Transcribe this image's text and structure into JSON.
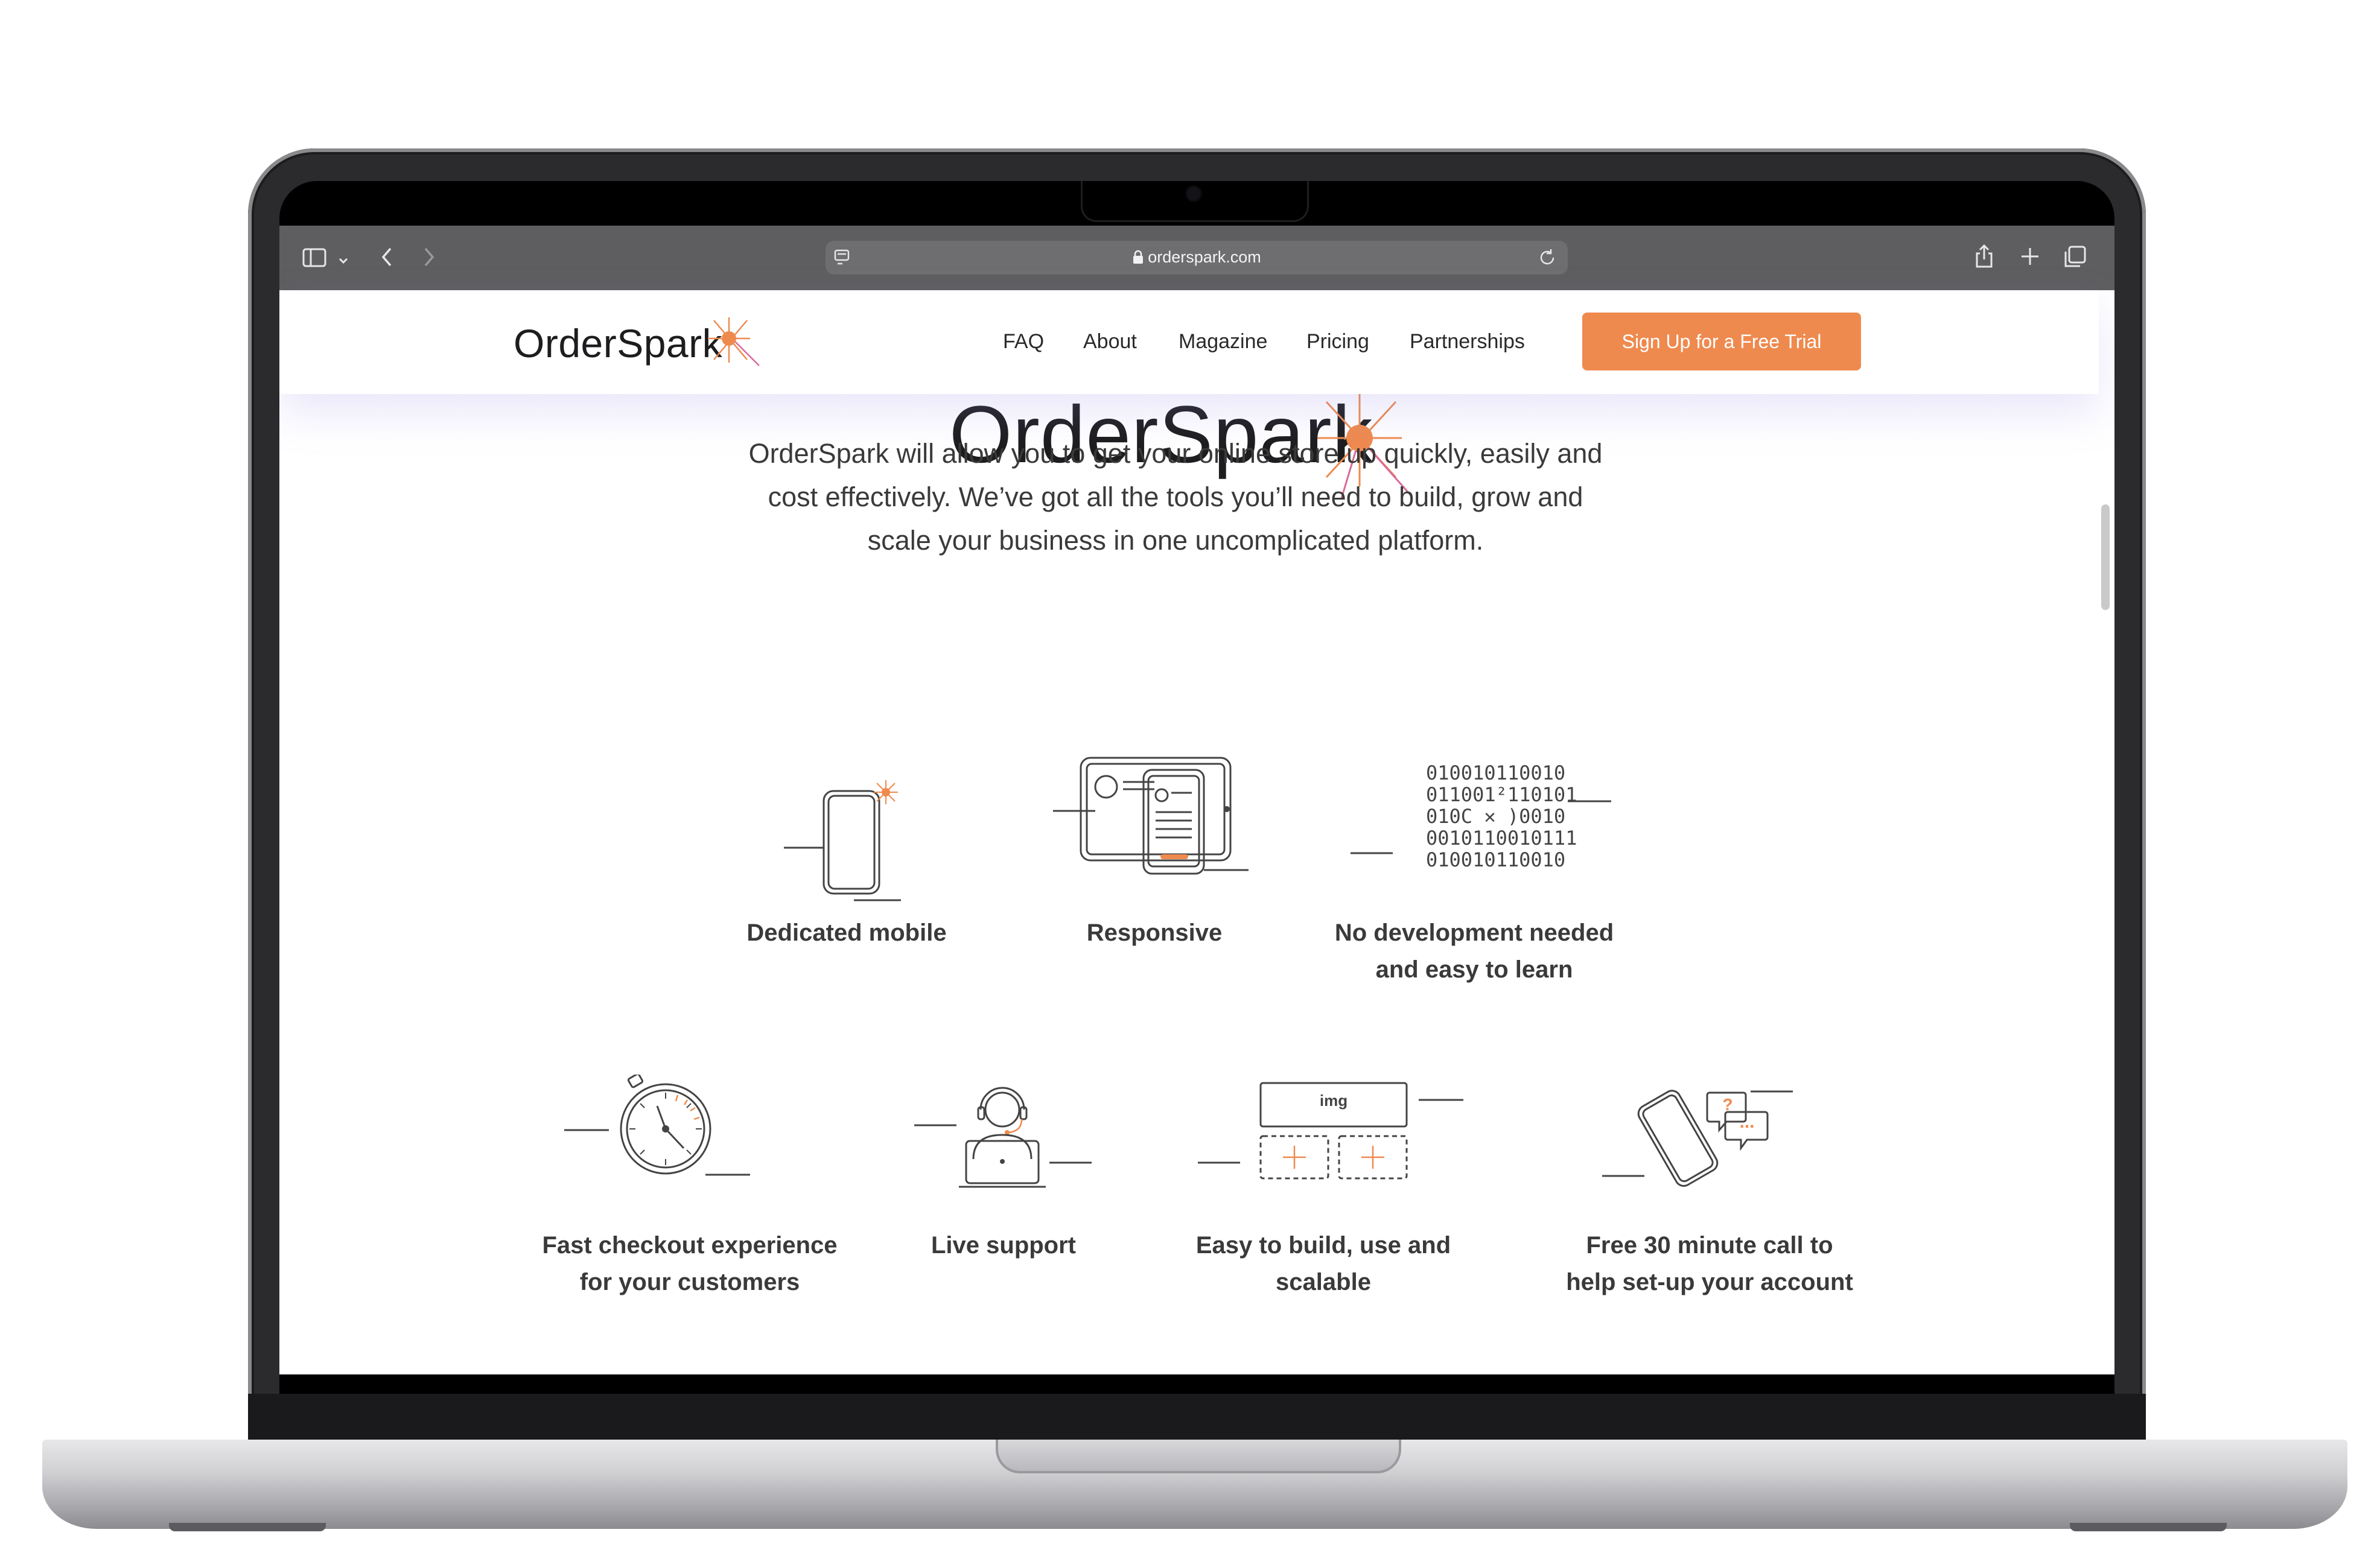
{
  "browser": {
    "url": "orderspark.com"
  },
  "site": {
    "logo": "OrderSpark",
    "nav": [
      "FAQ",
      "About",
      "Magazine",
      "Pricing",
      "Partnerships"
    ],
    "cta_label": "Sign Up for a Free Trial",
    "accent_color": "#ef8a4f"
  },
  "hero": {
    "logo": "OrderSpark",
    "intro_lines": [
      "OrderSpark will allow you to get your online store up quickly, easily and",
      "cost effectively. We’ve got all the tools you’ll need to build, grow and",
      "scale your business in one uncomplicated platform."
    ]
  },
  "features_row1": [
    {
      "icon": "mobile-icon",
      "label_lines": [
        "Dedicated mobile"
      ]
    },
    {
      "icon": "responsive-icon",
      "label_lines": [
        "Responsive"
      ]
    },
    {
      "icon": "binary-code-icon",
      "label_lines": [
        "No development needed",
        "and easy to learn"
      ]
    }
  ],
  "features_row2": [
    {
      "icon": "stopwatch-icon",
      "label_lines": [
        "Fast checkout experience",
        "for your customers"
      ]
    },
    {
      "icon": "support-agent-icon",
      "label_lines": [
        "Live support"
      ]
    },
    {
      "icon": "builder-blocks-icon",
      "label_lines": [
        "Easy to build, use and",
        "scalable"
      ]
    },
    {
      "icon": "phone-chat-icon",
      "label_lines": [
        "Free 30 minute call to",
        "help set-up your account"
      ]
    }
  ],
  "illustrations": {
    "binary_lines": [
      "010010110010",
      "011001²110101",
      "010C ✕ )0010",
      "0010110010111",
      "010010110010"
    ],
    "builder_img_label": "img",
    "chat_bubble_question": "?",
    "chat_bubble_dots": "..."
  }
}
